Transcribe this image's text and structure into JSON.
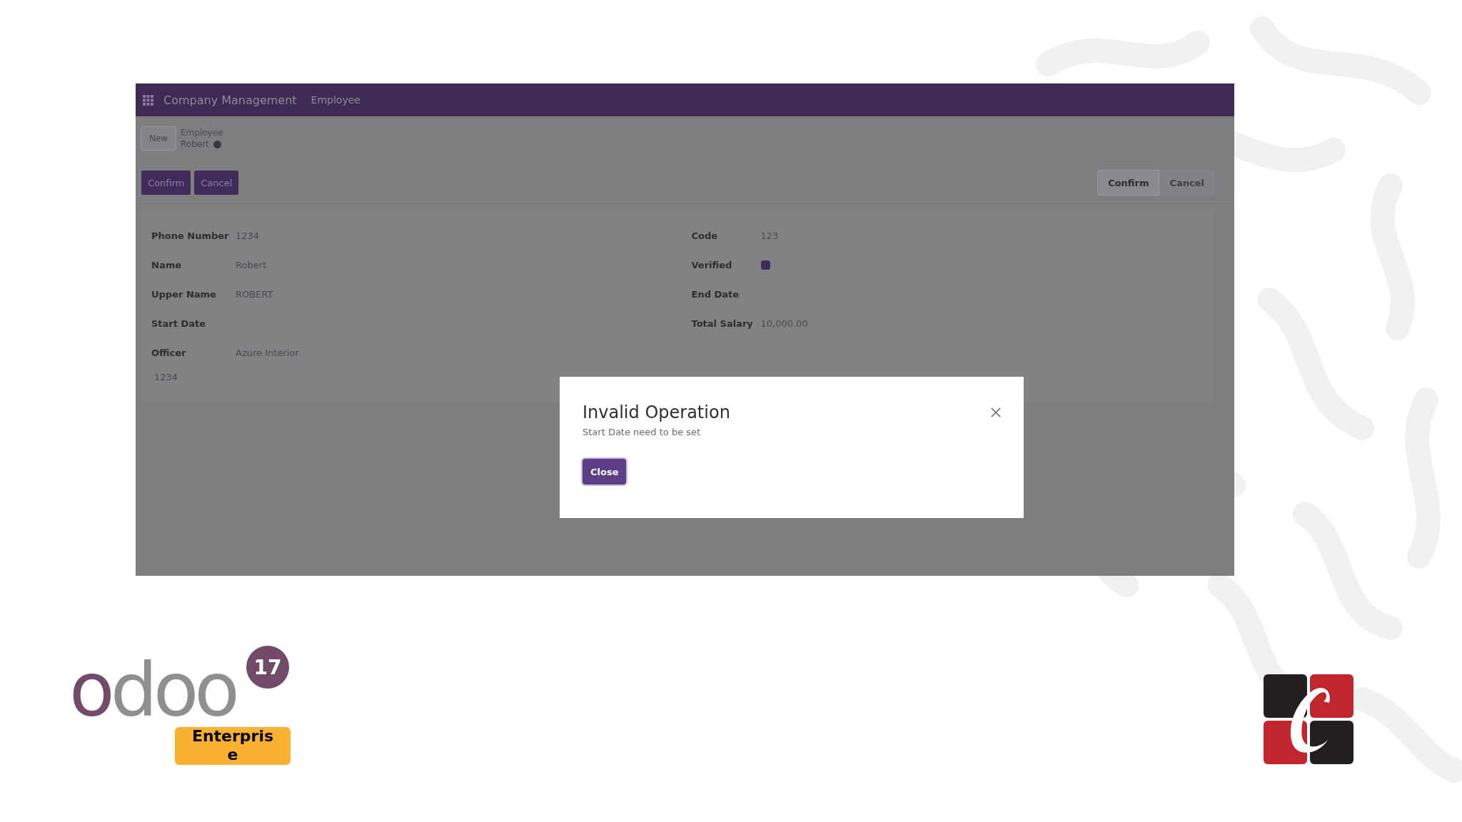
{
  "app": {
    "navbar": {
      "app_name": "Company Management",
      "menu_items": [
        "Employee"
      ]
    },
    "control_panel": {
      "new_button": "New",
      "breadcrumb": "Employee",
      "record_name": "Robert"
    },
    "action_buttons": [
      "Confirm",
      "Cancel"
    ],
    "status_bar": [
      {
        "label": "Confirm",
        "selected": true
      },
      {
        "label": "Cancel",
        "selected": false
      }
    ],
    "form": {
      "left_fields": [
        {
          "label": "Phone Number",
          "kind": "text",
          "value": "1234"
        },
        {
          "label": "Name",
          "kind": "text",
          "value": "Robert"
        },
        {
          "label": "Upper Name",
          "kind": "text",
          "value": "ROBERT"
        },
        {
          "label": "Start Date",
          "kind": "text"
        },
        {
          "label": "Officer",
          "kind": "text",
          "value": "Azure Interior"
        }
      ],
      "right_fields": [
        {
          "label": "Code",
          "kind": "text",
          "value": "123"
        },
        {
          "label": "Verified",
          "kind": "checkbox",
          "checked": true
        },
        {
          "label": "End Date",
          "kind": "text"
        },
        {
          "label": "Total Salary",
          "kind": "text",
          "value": "10,000.00"
        }
      ],
      "footer_value": "1234"
    },
    "dialog": {
      "title": "Invalid Operation",
      "message": "Start Date need to be set",
      "button": "Close"
    }
  },
  "odoo_logo": {
    "wordmark": "odoo",
    "version": "17",
    "edition": "Enterprise"
  }
}
